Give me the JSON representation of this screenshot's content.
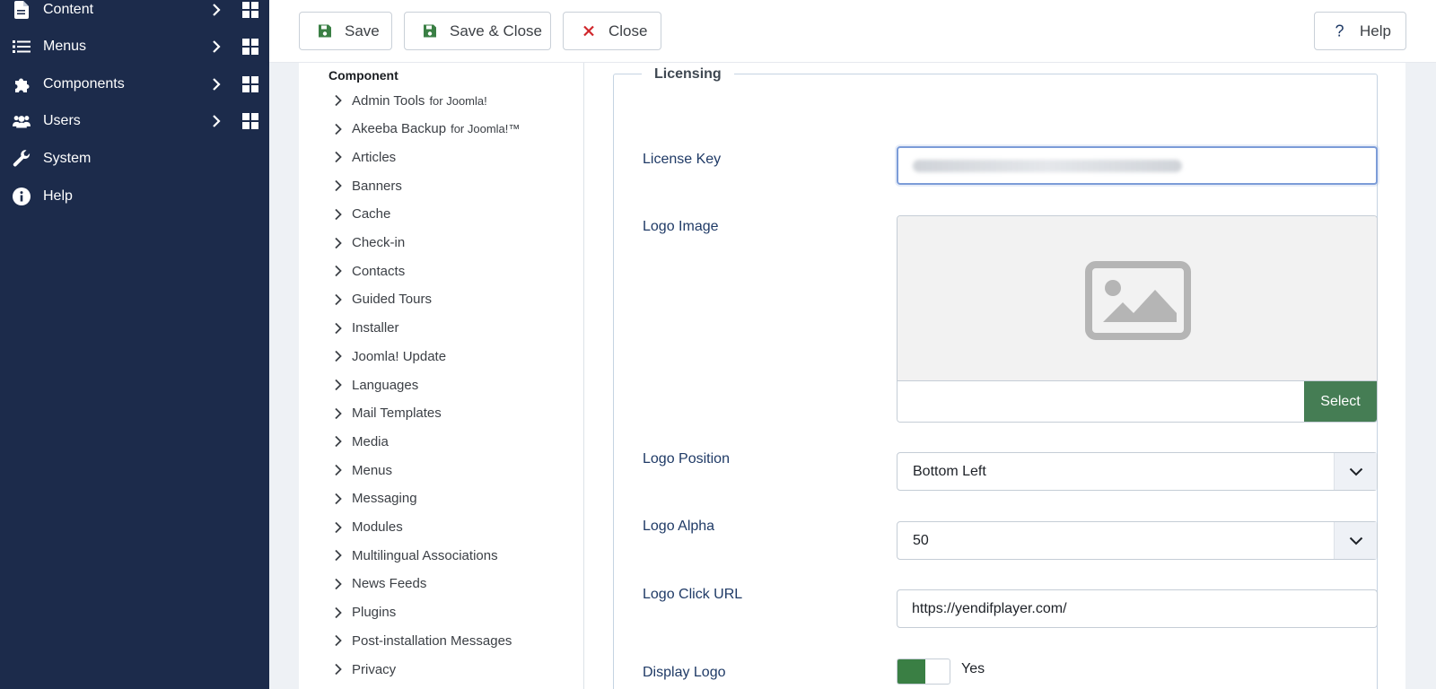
{
  "sidebar": {
    "items": [
      {
        "label": "Content",
        "icon": "file-icon",
        "has_children": true
      },
      {
        "label": "Menus",
        "icon": "list-icon",
        "has_children": true
      },
      {
        "label": "Components",
        "icon": "puzzle-icon",
        "has_children": true
      },
      {
        "label": "Users",
        "icon": "users-icon",
        "has_children": true
      },
      {
        "label": "System",
        "icon": "wrench-icon",
        "has_children": false
      },
      {
        "label": "Help",
        "icon": "info-icon",
        "has_children": false
      }
    ]
  },
  "toolbar": {
    "save_label": "Save",
    "save_close_label": "Save & Close",
    "close_label": "Close",
    "help_label": "Help"
  },
  "tree": {
    "heading": "Component",
    "items": [
      {
        "label": "Admin Tools",
        "suffix": "for Joomla!"
      },
      {
        "label": "Akeeba Backup",
        "suffix": "for Joomla!™"
      },
      {
        "label": "Articles"
      },
      {
        "label": "Banners"
      },
      {
        "label": "Cache"
      },
      {
        "label": "Check-in"
      },
      {
        "label": "Contacts"
      },
      {
        "label": "Guided Tours"
      },
      {
        "label": "Installer"
      },
      {
        "label": "Joomla! Update"
      },
      {
        "label": "Languages"
      },
      {
        "label": "Mail Templates"
      },
      {
        "label": "Media"
      },
      {
        "label": "Menus"
      },
      {
        "label": "Messaging"
      },
      {
        "label": "Modules"
      },
      {
        "label": "Multilingual Associations"
      },
      {
        "label": "News Feeds"
      },
      {
        "label": "Plugins"
      },
      {
        "label": "Post-installation Messages"
      },
      {
        "label": "Privacy"
      }
    ]
  },
  "form": {
    "legend": "Licensing",
    "license_key_label": "License Key",
    "license_key_value": "",
    "logo_image_label": "Logo Image",
    "select_label": "Select",
    "logo_position_label": "Logo Position",
    "logo_position_value": "Bottom Left",
    "logo_alpha_label": "Logo Alpha",
    "logo_alpha_value": "50",
    "logo_click_url_label": "Logo Click URL",
    "logo_click_url_value": "https://yendifplayer.com/",
    "display_logo_label": "Display Logo",
    "display_logo_value": "Yes"
  },
  "colors": {
    "sidebar_bg": "#1c2b4b",
    "save_icon": "#3a7f44",
    "close_icon": "#d0262b",
    "select_button": "#457d54",
    "toggle_on": "#3a7f44"
  }
}
